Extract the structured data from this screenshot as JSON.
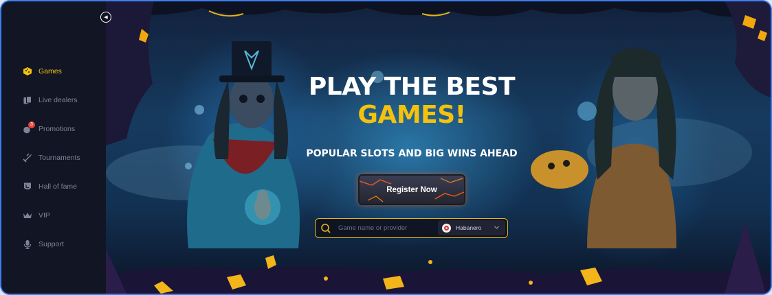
{
  "sidebar": {
    "items": [
      {
        "label": "Games",
        "icon": "dice-icon",
        "active": true
      },
      {
        "label": "Live dealers",
        "icon": "cards-icon",
        "active": false
      },
      {
        "label": "Promotions",
        "icon": "bomb-icon",
        "active": false,
        "badge": "3"
      },
      {
        "label": "Tournaments",
        "icon": "swords-icon",
        "active": false
      },
      {
        "label": "Hall of fame",
        "icon": "crest-icon",
        "active": false
      },
      {
        "label": "VIP",
        "icon": "crown-icon",
        "active": false
      },
      {
        "label": "Support",
        "icon": "microphone-icon",
        "active": false
      }
    ],
    "collapse_icon": "collapse-left-icon"
  },
  "hero": {
    "title_line1": "PLAY THE BEST",
    "title_line2": "GAMES!",
    "subtitle": "POPULAR SLOTS AND BIG WINS AHEAD",
    "cta_label": "Register Now",
    "search": {
      "placeholder": "Game name or provider",
      "value": ""
    },
    "provider": {
      "selected": "Habanero",
      "icon": "habanero-logo-icon"
    }
  },
  "colors": {
    "accent": "#f4c20d",
    "sidebar_bg": "#121524",
    "nav_text": "#7d8397",
    "frame_border": "#3d7ff0",
    "badge": "#e5453a"
  }
}
